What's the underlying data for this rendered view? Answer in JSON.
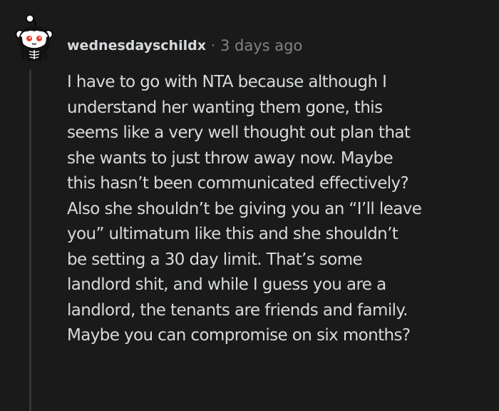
{
  "comment": {
    "username": "wednesdayschildx",
    "separator": "·",
    "timestamp": "3 days ago",
    "body_lines": [
      "I have to go with NTA because although I",
      "understand her wanting them gone, this",
      "seems like a very well thought out plan that",
      "she wants to just throw away now. Maybe",
      "this hasn’t been communicated effectively?",
      "Also she shouldn’t be giving you an “I’ll leave",
      "you” ultimatum like this and she shouldn’t",
      "be setting a 30 day limit. That’s some",
      "landlord shit, and while I guess you are a",
      "landlord, the tenants are friends and family.",
      "Maybe you can compromise on six months?"
    ]
  },
  "icons": {
    "avatar": "snoo-skeleton-avatar-icon"
  },
  "colors": {
    "background": "#1a1a1b",
    "text": "#d7dadc",
    "meta": "#818384",
    "thread_line": "#343536",
    "avatar_eyes": "#e8442f"
  }
}
